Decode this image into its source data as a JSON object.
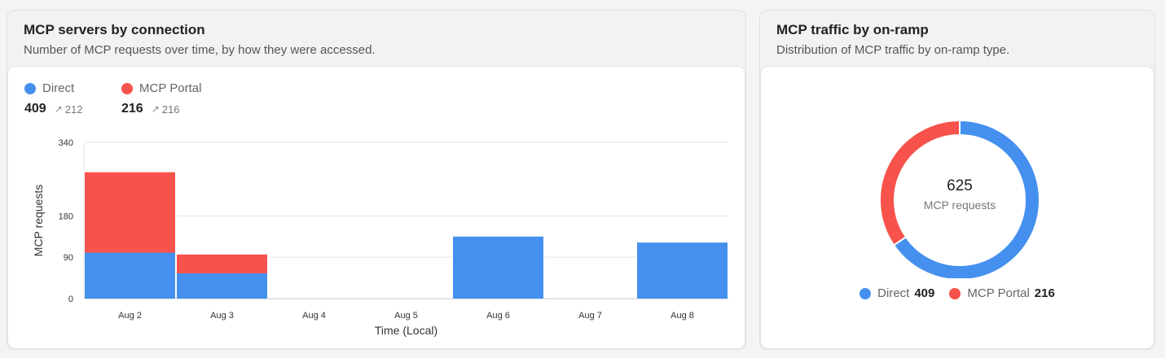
{
  "colors": {
    "direct": "#4590EE",
    "portal": "#F8524C"
  },
  "left_card": {
    "title": "MCP servers by connection",
    "subtitle": "Number of MCP requests over time, by how they were accessed.",
    "legend": [
      {
        "name": "Direct",
        "total": "409",
        "trend": "212"
      },
      {
        "name": "MCP Portal",
        "total": "216",
        "trend": "216"
      }
    ]
  },
  "right_card": {
    "title": "MCP traffic by on-ramp",
    "subtitle": "Distribution of MCP traffic by on-ramp type.",
    "center_total": "625",
    "center_label": "MCP requests",
    "legend": [
      {
        "name": "Direct",
        "value": "409"
      },
      {
        "name": "MCP Portal",
        "value": "216"
      }
    ]
  },
  "chart_data": [
    {
      "type": "bar",
      "stacked": true,
      "categories": [
        "Aug 2",
        "Aug 3",
        "Aug 4",
        "Aug 5",
        "Aug 6",
        "Aug 7",
        "Aug 8"
      ],
      "series": [
        {
          "name": "Direct",
          "values": [
            100,
            55,
            0,
            0,
            135,
            0,
            122
          ]
        },
        {
          "name": "MCP Portal",
          "values": [
            175,
            41,
            0,
            0,
            0,
            0,
            0
          ]
        }
      ],
      "xlabel": "Time (Local)",
      "ylabel": "MCP requests",
      "yticks": [
        0,
        90,
        180,
        340
      ],
      "ylim": [
        0,
        340
      ],
      "grid": true
    },
    {
      "type": "pie",
      "donut": true,
      "labels": [
        "Direct",
        "MCP Portal"
      ],
      "values": [
        409,
        216
      ]
    }
  ]
}
